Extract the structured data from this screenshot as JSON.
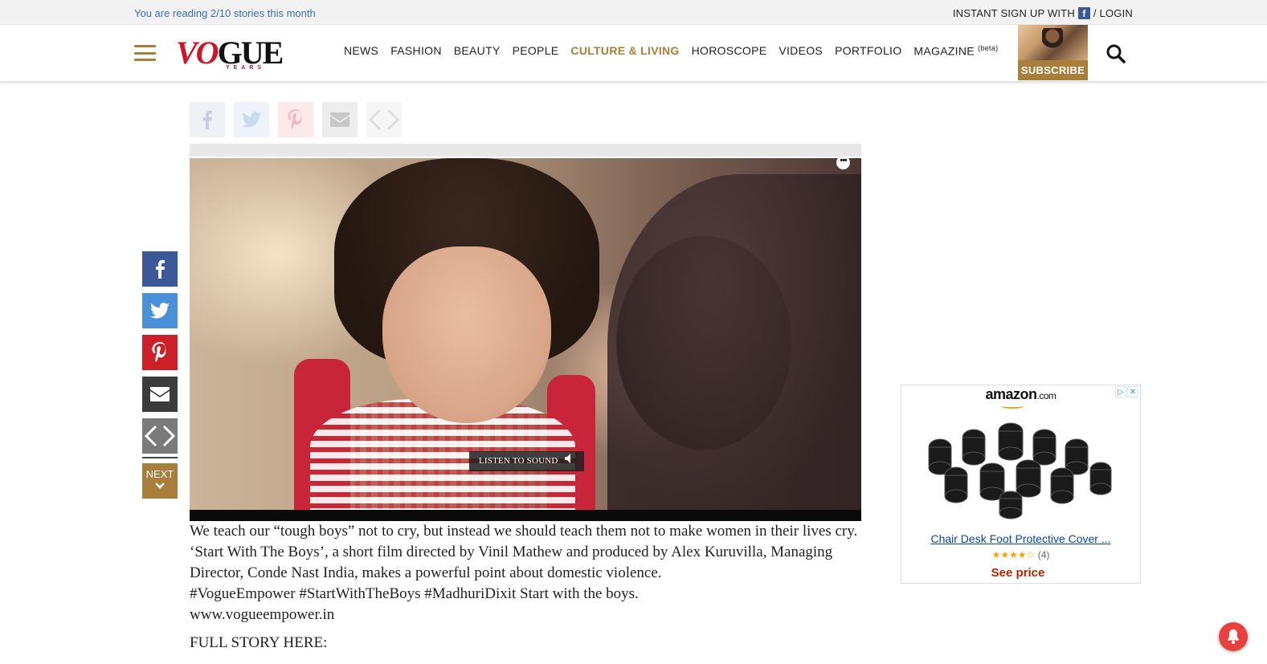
{
  "topbar": {
    "reading_text": "You are reading 2/10 stories this month",
    "signup_text": "INSTANT SIGN UP WITH",
    "facebook_letter": "f",
    "login_text": "/ LOGIN"
  },
  "header": {
    "logo_main_red": "VO",
    "logo_main": "GUE",
    "logo_sub": "YEARS",
    "nav": [
      {
        "label": "NEWS"
      },
      {
        "label": "FASHION"
      },
      {
        "label": "BEAUTY"
      },
      {
        "label": "PEOPLE"
      },
      {
        "label": "CULTURE & LIVING"
      },
      {
        "label": "HOROSCOPE"
      },
      {
        "label": "VIDEOS"
      },
      {
        "label": "PORTFOLIO"
      },
      {
        "label": "MAGAZINE",
        "sup": "(beta)"
      }
    ],
    "subscribe_label": "SUBSCRIBE"
  },
  "video": {
    "listen_label": "LISTEN TO SOUND",
    "more_label": "•••"
  },
  "side_share": {
    "next_label": "NEXT"
  },
  "article": {
    "body": "We teach our “tough boys” not to cry, but instead we should teach them not to make women in their lives cry. ‘Start With The Boys’, a short film directed by Vinil Mathew and produced by Alex Kuruvilla, Managing Director, Conde Nast India, makes a powerful point about domestic violence.",
    "hashtags": "#VogueEmpower #StartWithTheBoys #MadhuriDixit Start with the boys.",
    "url": "www.vogueempower.in",
    "full_story": "FULL STORY HERE:"
  },
  "ad": {
    "brand": "amazon",
    "brand_suffix": ".com",
    "product_title": "Chair Desk Foot Protective Cover ...",
    "stars": "★★★★☆",
    "review_count": "(4)",
    "price_label": "See price",
    "adchoice_play": "▷",
    "adchoice_close": "✕"
  },
  "colors": {
    "accent_gold": "#a77e3a",
    "logo_red": "#d0142a",
    "facebook": "#3b5998",
    "twitter": "#4a90d9",
    "pinterest": "#cb2027"
  },
  "icons": [
    "menu-icon",
    "search-icon",
    "facebook-icon",
    "twitter-icon",
    "pinterest-icon",
    "mail-icon",
    "embed-icon",
    "chevron-down-icon",
    "speaker-icon",
    "bell-icon"
  ]
}
